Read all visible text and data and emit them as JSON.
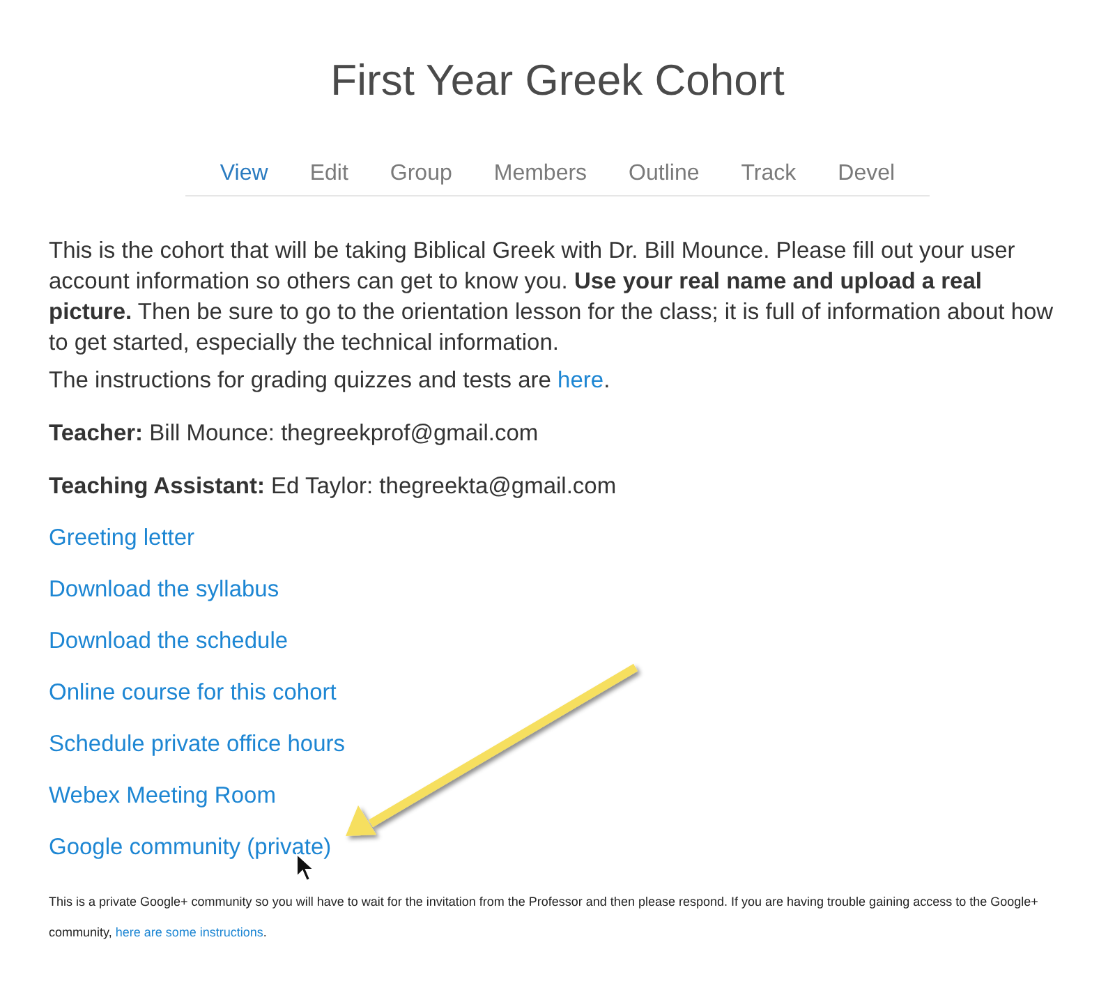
{
  "title": "First Year Greek Cohort",
  "tabs": [
    {
      "label": "View",
      "selected": true
    },
    {
      "label": "Edit",
      "selected": false
    },
    {
      "label": "Group",
      "selected": false
    },
    {
      "label": "Members",
      "selected": false
    },
    {
      "label": "Outline",
      "selected": false
    },
    {
      "label": "Track",
      "selected": false
    },
    {
      "label": "Devel",
      "selected": false
    }
  ],
  "intro": "This is the cohort that will be taking Biblical Greek with Dr. Bill Mounce. Please fill out your user account information so others can get to know you. **Use your real name and upload a real picture.** Then be sure to go to the orientation lesson for the class; it is full of information about how to get started, especially the technical information.",
  "instructions": {
    "text": "The instructions for grading quizzes and tests are ",
    "link": "here",
    "after": "."
  },
  "contacts": [
    "**Teacher:** Bill Mounce: thegreekprof@gmail.com",
    "**Teaching Assistant:** Ed Taylor: thegreekta@gmail.com"
  ],
  "links": [
    "Greeting letter",
    "Download the syllabus",
    "Download the schedule",
    "Online course for this cohort",
    "Schedule private office hours",
    "Webex Meeting Room",
    "Google community (private)"
  ],
  "note": {
    "text": "This is a private Google+ community so you will have to wait for the invitation from the Professor and then please respond. If you are having trouble gaining access to the Google+ community, ",
    "link": "here are some instructions",
    "after": "."
  }
}
